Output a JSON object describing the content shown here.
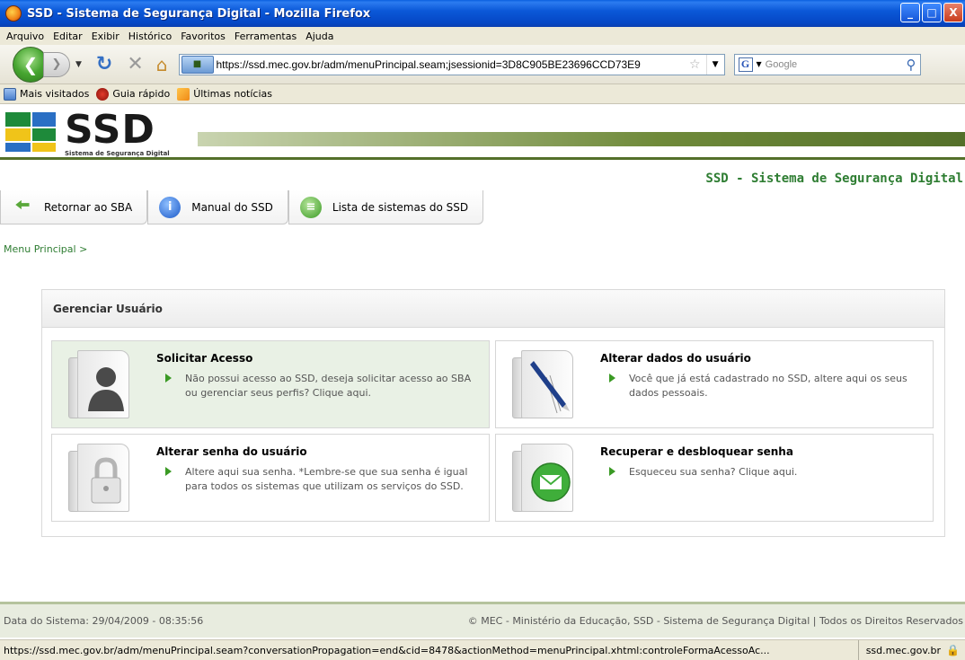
{
  "window": {
    "title": "SSD - Sistema de Segurança Digital - Mozilla Firefox",
    "buttons": {
      "minimize": "_",
      "maximize": "□",
      "close": "X"
    }
  },
  "menubar": {
    "items": [
      {
        "label": "Arquivo"
      },
      {
        "label": "Editar"
      },
      {
        "label": "Exibir"
      },
      {
        "label": "Histórico"
      },
      {
        "label": "Favoritos"
      },
      {
        "label": "Ferramentas"
      },
      {
        "label": "Ajuda"
      }
    ]
  },
  "navbar": {
    "url": "https://ssd.mec.gov.br/adm/menuPrincipal.seam;jsessionid=3D8C905BE23696CCD73E9",
    "search_placeholder": "Google"
  },
  "bookmarks": [
    {
      "label": "Mais visitados",
      "icon": "folder-icon"
    },
    {
      "label": "Guia rápido",
      "icon": "firefox-guide-icon"
    },
    {
      "label": "Últimas notícias",
      "icon": "rss-icon"
    }
  ],
  "header": {
    "logo_text": "SSD",
    "logo_subtitle": "Sistema de Segurança Digital",
    "system_title": "SSD - Sistema de Segurança Digital"
  },
  "tabs": [
    {
      "label": "Retornar ao SBA",
      "icon": "arrow-left-icon"
    },
    {
      "label": "Manual do SSD",
      "icon": "info-icon"
    },
    {
      "label": "Lista de sistemas do SSD",
      "icon": "list-icon"
    }
  ],
  "breadcrumb": "Menu Principal >",
  "panel": {
    "title": "Gerenciar Usuário",
    "cards": [
      {
        "title": "Solicitar Acesso",
        "desc": "Não possui acesso ao SSD, deseja solicitar acesso ao SBA ou gerenciar seus perfis? Clique aqui.",
        "icon": "user-silhouette-icon"
      },
      {
        "title": "Alterar dados do usuário",
        "desc": "Você que já está cadastrado no SSD, altere aqui os seus dados pessoais.",
        "icon": "pen-document-icon"
      },
      {
        "title": "Alterar senha do usuário",
        "desc": "Altere aqui sua senha. *Lembre-se que sua senha é igual para todos os sistemas que utilizam os serviços do SSD.",
        "icon": "padlock-icon"
      },
      {
        "title": "Recuperar e desbloquear senha",
        "desc": "Esqueceu sua senha? Clique aqui.",
        "icon": "envelope-icon"
      }
    ]
  },
  "footer": {
    "date": "Data do Sistema: 29/04/2009 - 08:35:56",
    "copyright": "© MEC - Ministério da Educação, SSD - Sistema de Segurança Digital | Todos os Direitos Reservados"
  },
  "statusbar": {
    "url": "https://ssd.mec.gov.br/adm/menuPrincipal.seam?conversationPropagation=end&cid=8478&actionMethod=menuPrincipal.xhtml:controleFormaAcessoAc...",
    "host": "ssd.mec.gov.br"
  },
  "colors": {
    "accent_green": "#2e7d32",
    "titlebar_blue": "#0b58d8",
    "card_highlight": "#e9f1e5"
  }
}
